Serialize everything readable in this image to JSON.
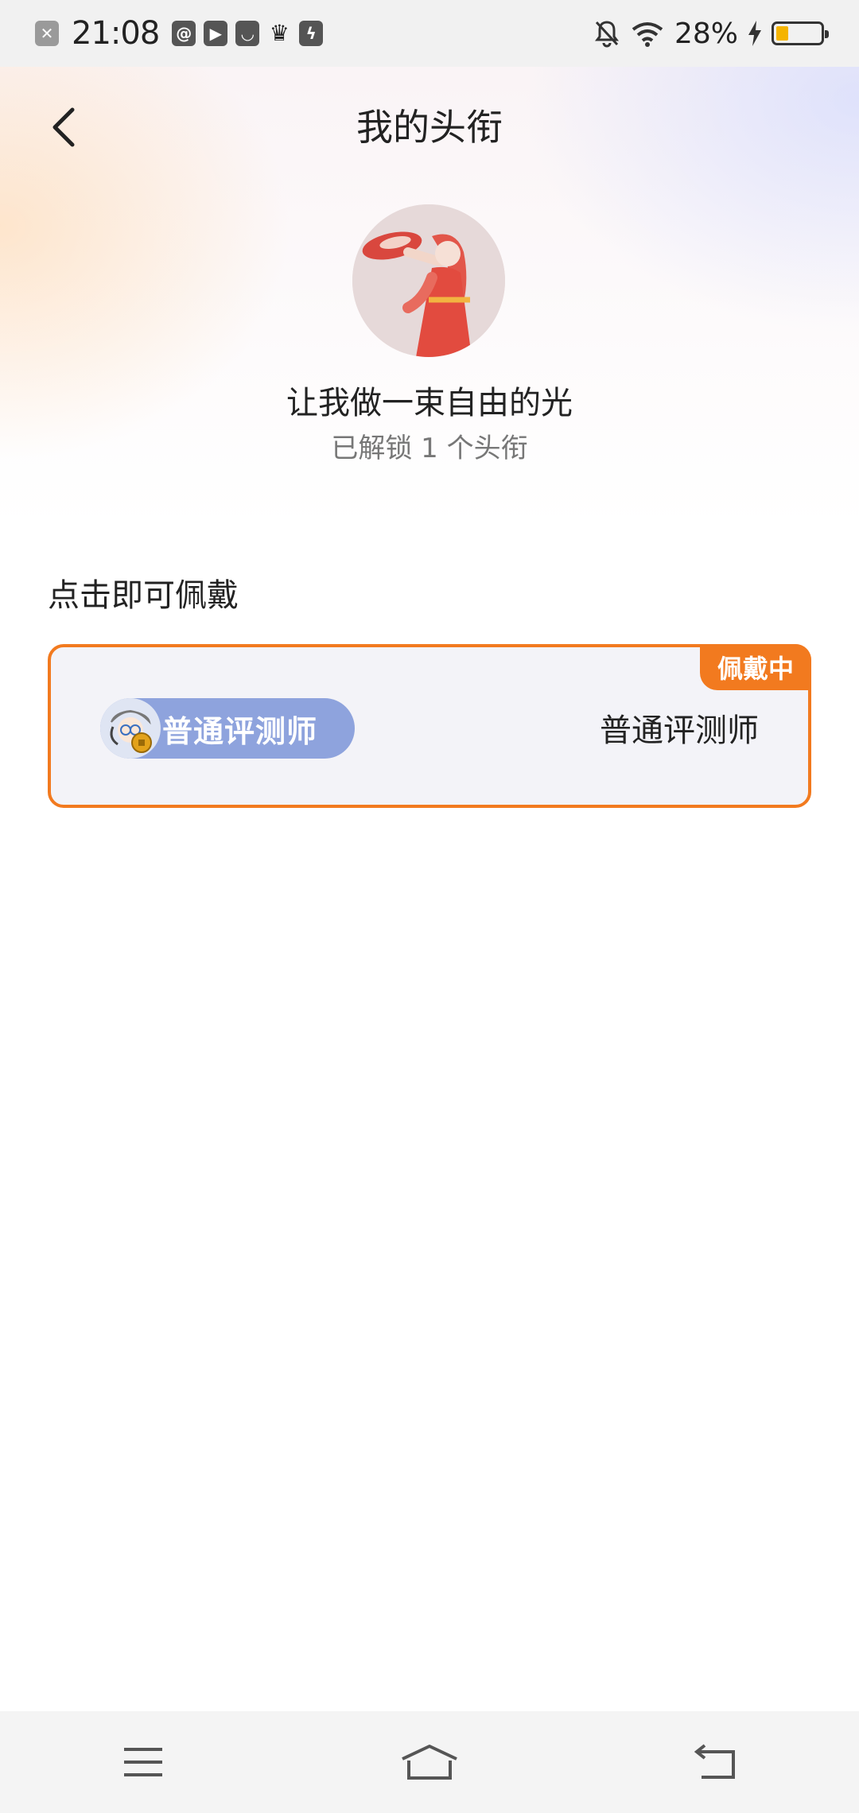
{
  "status_bar": {
    "time": "21:08",
    "battery_percent": "28%",
    "battery_level": 0.28,
    "icons": [
      "close-app-icon",
      "at-app-icon",
      "play-app-icon",
      "pocket-app-icon",
      "crown-app-icon",
      "bolt-app-icon",
      "bell-off-icon",
      "wifi-icon",
      "charging-icon",
      "battery-icon"
    ]
  },
  "header": {
    "title": "我的头衔",
    "back_icon": "chevron-left-icon"
  },
  "profile": {
    "username": "让我做一束自由的光",
    "unlock_text": "已解锁 1 个头衔"
  },
  "section": {
    "label": "点击即可佩戴"
  },
  "titles": [
    {
      "pill_label": "普通评测师",
      "name": "普通评测师",
      "badge": "佩戴中",
      "accent": "#f27a1f",
      "pill_color": "#8ea3dd"
    }
  ],
  "nav": {
    "icons": [
      "menu-icon",
      "home-icon",
      "back-icon"
    ]
  }
}
